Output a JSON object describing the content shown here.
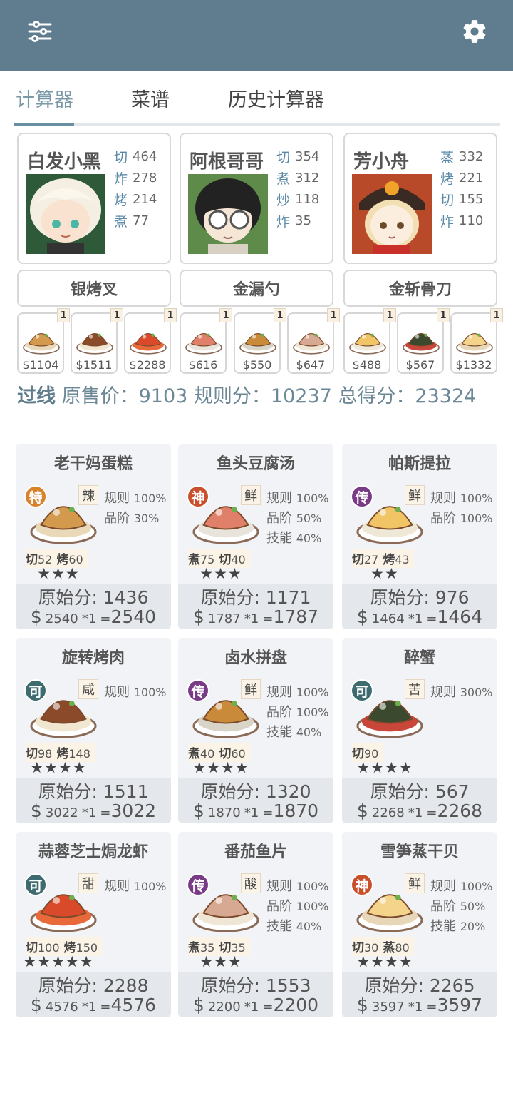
{
  "topbar": {
    "menu_icon": "sliders-icon",
    "settings_icon": "gear-icon"
  },
  "tabs": [
    {
      "label": "计算器",
      "active": true
    },
    {
      "label": "菜谱"
    },
    {
      "label": "历史计算器"
    }
  ],
  "chefs": [
    {
      "name": "白发小黑",
      "skills": [
        {
          "k": "切",
          "v": "464"
        },
        {
          "k": "炸",
          "v": "278"
        },
        {
          "k": "烤",
          "v": "214"
        },
        {
          "k": "煮",
          "v": "77"
        }
      ]
    },
    {
      "name": "阿根哥哥",
      "skills": [
        {
          "k": "切",
          "v": "354"
        },
        {
          "k": "煮",
          "v": "312"
        },
        {
          "k": "炒",
          "v": "118"
        },
        {
          "k": "炸",
          "v": "35"
        }
      ]
    },
    {
      "name": "芳小舟",
      "skills": [
        {
          "k": "蒸",
          "v": "332"
        },
        {
          "k": "烤",
          "v": "221"
        },
        {
          "k": "切",
          "v": "155"
        },
        {
          "k": "炸",
          "v": "110"
        }
      ]
    }
  ],
  "equipment": [
    "银烤叉",
    "金漏勺",
    "金斩骨刀"
  ],
  "selected_dishes": [
    {
      "price": "$1104",
      "qty": "1"
    },
    {
      "price": "$1511",
      "qty": "1"
    },
    {
      "price": "$2288",
      "qty": "1"
    },
    {
      "price": "$616",
      "qty": "1"
    },
    {
      "price": "$550",
      "qty": "1"
    },
    {
      "price": "$647",
      "qty": "1"
    },
    {
      "price": "$488",
      "qty": "1"
    },
    {
      "price": "$567",
      "qty": "1"
    },
    {
      "price": "$1332",
      "qty": "1"
    }
  ],
  "summary": {
    "pass": "过线",
    "orig_label": "原售价：",
    "orig_value": "9103",
    "rule_label": "规则分：",
    "rule_value": "10237",
    "total_label": "总得分：",
    "total_value": "23324"
  },
  "recipes": [
    {
      "name": "老干妈蛋糕",
      "rarity": "特",
      "rarity_color": "#d9822b",
      "taste": "辣",
      "mods": [
        {
          "k": "规则",
          "v": "100%"
        },
        {
          "k": "品阶",
          "v": "30%"
        }
      ],
      "reqs": [
        {
          "k": "切",
          "v": "52"
        },
        {
          "k": "烤",
          "v": "60"
        }
      ],
      "stars": "★★★",
      "raw_label": "原始分:",
      "raw": "1436",
      "price": "2540",
      "mult": "*1",
      "total": "2540"
    },
    {
      "name": "鱼头豆腐汤",
      "rarity": "神",
      "rarity_color": "#c8502c",
      "taste": "鲜",
      "mods": [
        {
          "k": "规则",
          "v": "100%"
        },
        {
          "k": "品阶",
          "v": "50%"
        },
        {
          "k": "技能",
          "v": "40%"
        }
      ],
      "reqs": [
        {
          "k": "煮",
          "v": "75"
        },
        {
          "k": "切",
          "v": "40"
        }
      ],
      "stars": "★★★",
      "raw_label": "原始分:",
      "raw": "1171",
      "price": "1787",
      "mult": "*1",
      "total": "1787"
    },
    {
      "name": "帕斯提拉",
      "rarity": "传",
      "rarity_color": "#7a3b86",
      "taste": "鲜",
      "mods": [
        {
          "k": "规则",
          "v": "100%"
        },
        {
          "k": "品阶",
          "v": "100%"
        }
      ],
      "reqs": [
        {
          "k": "切",
          "v": "27"
        },
        {
          "k": "烤",
          "v": "43"
        }
      ],
      "stars": "★★",
      "raw_label": "原始分:",
      "raw": "976",
      "price": "1464",
      "mult": "*1",
      "total": "1464"
    },
    {
      "name": "旋转烤肉",
      "rarity": "可",
      "rarity_color": "#3d6b70",
      "taste": "咸",
      "mods": [
        {
          "k": "规则",
          "v": "100%"
        }
      ],
      "reqs": [
        {
          "k": "切",
          "v": "98"
        },
        {
          "k": "烤",
          "v": "148"
        }
      ],
      "stars": "★★★★",
      "raw_label": "原始分:",
      "raw": "1511",
      "price": "3022",
      "mult": "*1",
      "total": "3022"
    },
    {
      "name": "卤水拼盘",
      "rarity": "传",
      "rarity_color": "#7a3b86",
      "taste": "鲜",
      "mods": [
        {
          "k": "规则",
          "v": "100%"
        },
        {
          "k": "品阶",
          "v": "100%"
        },
        {
          "k": "技能",
          "v": "40%"
        }
      ],
      "reqs": [
        {
          "k": "煮",
          "v": "40"
        },
        {
          "k": "切",
          "v": "60"
        }
      ],
      "stars": "★★★★",
      "raw_label": "原始分:",
      "raw": "1320",
      "price": "1870",
      "mult": "*1",
      "total": "1870"
    },
    {
      "name": "醉蟹",
      "rarity": "可",
      "rarity_color": "#3d6b70",
      "taste": "苦",
      "mods": [
        {
          "k": "规则",
          "v": "300%"
        }
      ],
      "reqs": [
        {
          "k": "切",
          "v": "90"
        }
      ],
      "stars": "★★★★",
      "raw_label": "原始分:",
      "raw": "567",
      "price": "2268",
      "mult": "*1",
      "total": "2268"
    },
    {
      "name": "蒜蓉芝士焗龙虾",
      "rarity": "可",
      "rarity_color": "#3d6b70",
      "taste": "甜",
      "mods": [
        {
          "k": "规则",
          "v": "100%"
        }
      ],
      "reqs": [
        {
          "k": "切",
          "v": "100"
        },
        {
          "k": "烤",
          "v": "150"
        }
      ],
      "stars": "★★★★★",
      "raw_label": "原始分:",
      "raw": "2288",
      "price": "4576",
      "mult": "*1",
      "total": "4576"
    },
    {
      "name": "番茄鱼片",
      "rarity": "传",
      "rarity_color": "#7a3b86",
      "taste": "酸",
      "mods": [
        {
          "k": "规则",
          "v": "100%"
        },
        {
          "k": "品阶",
          "v": "100%"
        },
        {
          "k": "技能",
          "v": "40%"
        }
      ],
      "reqs": [
        {
          "k": "煮",
          "v": "35"
        },
        {
          "k": "切",
          "v": "35"
        }
      ],
      "stars": "★★★",
      "raw_label": "原始分:",
      "raw": "1553",
      "price": "2200",
      "mult": "*1",
      "total": "2200"
    },
    {
      "name": "雪笋蒸干贝",
      "rarity": "神",
      "rarity_color": "#c8502c",
      "taste": "鲜",
      "mods": [
        {
          "k": "规则",
          "v": "100%"
        },
        {
          "k": "品阶",
          "v": "50%"
        },
        {
          "k": "技能",
          "v": "20%"
        }
      ],
      "reqs": [
        {
          "k": "切",
          "v": "30"
        },
        {
          "k": "蒸",
          "v": "80"
        }
      ],
      "stars": "★★★★",
      "raw_label": "原始分:",
      "raw": "2265",
      "price": "3597",
      "mult": "*1",
      "total": "3597"
    }
  ]
}
